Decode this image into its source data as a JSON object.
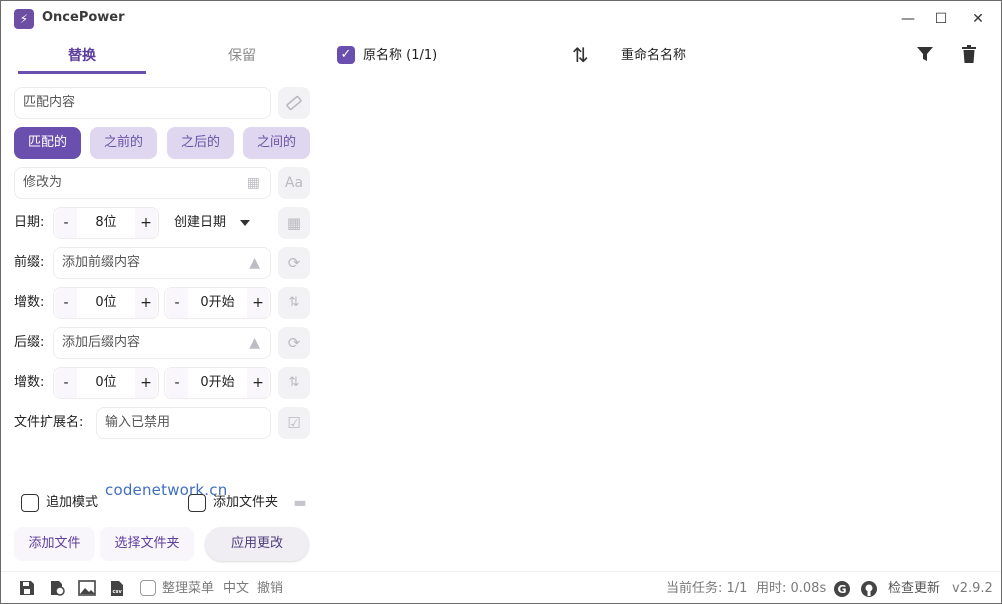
{
  "app": {
    "title": "OncePower",
    "icon": "lightning-icon"
  },
  "window_controls": {
    "minimize": "—",
    "maximize": "☐",
    "close": "✕"
  },
  "tabs": [
    {
      "label": "替换",
      "active": true
    },
    {
      "label": "保留",
      "active": false
    }
  ],
  "match_field": {
    "placeholder": "匹配内容"
  },
  "modes": [
    {
      "label": "匹配的",
      "active": true
    },
    {
      "label": "之前的",
      "active": false
    },
    {
      "label": "之后的",
      "active": false
    },
    {
      "label": "之间的",
      "active": false
    }
  ],
  "modify_field": {
    "placeholder": "修改为"
  },
  "date_row": {
    "label": "日期:",
    "digits": "8位",
    "type": "创建日期"
  },
  "prefix_row": {
    "label": "前缀:",
    "placeholder": "添加前缀内容"
  },
  "prefix_inc": {
    "label": "增数:",
    "digits": "0位",
    "start": "0开始"
  },
  "suffix_row": {
    "label": "后缀:",
    "placeholder": "添加后缀内容"
  },
  "suffix_inc": {
    "label": "增数:",
    "digits": "0位",
    "start": "0开始"
  },
  "ext_row": {
    "label": "文件扩展名:",
    "placeholder": "输入已禁用"
  },
  "stepper_symbols": {
    "minus": "-",
    "plus": "+"
  },
  "options": {
    "append_mode": "追加模式",
    "add_folder": "添加文件夹"
  },
  "watermark": "codenetwork.cn",
  "buttons": {
    "add_files": "添加文件",
    "select_folder": "选择文件夹",
    "apply": "应用更改"
  },
  "list_header": {
    "original": "原名称 (1/1)",
    "renamed": "重命名名称",
    "original_checked": true
  },
  "statusbar": {
    "organize_menu": "整理菜单",
    "language": "中文",
    "undo": "撤销",
    "current_task": "当前任务: 1/1",
    "time_used": "用时: 0.08s",
    "check_update": "检查更新",
    "version": "v2.9.2"
  },
  "colors": {
    "accent": "#6a4fae",
    "accent_light": "#ded7ef"
  }
}
